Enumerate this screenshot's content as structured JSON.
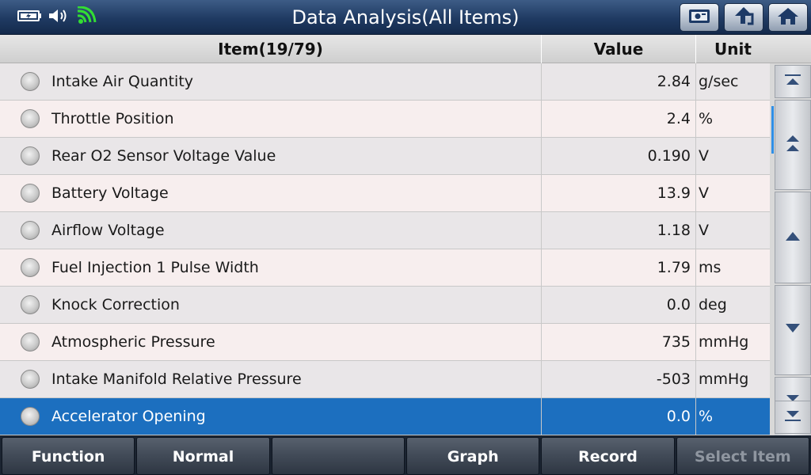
{
  "title": "Data Analysis(All Items)",
  "top_buttons": [
    "screen-capture-icon",
    "back-icon",
    "home-icon"
  ],
  "status_icons": [
    "battery-icon",
    "speaker-icon",
    "wifi-icon"
  ],
  "table": {
    "headers": {
      "item": "Item(19/79)",
      "value": "Value",
      "unit": "Unit"
    },
    "rows": [
      {
        "item": "Intake Air Quantity",
        "value": "2.84",
        "unit": "g/sec"
      },
      {
        "item": "Throttle Position",
        "value": "2.4",
        "unit": "%"
      },
      {
        "item": "Rear O2 Sensor Voltage Value",
        "value": "0.190",
        "unit": "V"
      },
      {
        "item": "Battery Voltage",
        "value": "13.9",
        "unit": "V"
      },
      {
        "item": "Airflow Voltage",
        "value": "1.18",
        "unit": "V"
      },
      {
        "item": "Fuel Injection 1 Pulse Width",
        "value": "1.79",
        "unit": "ms"
      },
      {
        "item": "Knock Correction",
        "value": "0.0",
        "unit": "deg"
      },
      {
        "item": "Atmospheric Pressure",
        "value": "735",
        "unit": "mmHg"
      },
      {
        "item": "Intake Manifold Relative Pressure",
        "value": "-503",
        "unit": "mmHg"
      },
      {
        "item": "Accelerator Opening",
        "value": "0.0",
        "unit": "%",
        "selected": true
      }
    ]
  },
  "bottom_buttons": [
    {
      "label": "Function",
      "enabled": true
    },
    {
      "label": "Normal",
      "enabled": true
    },
    {
      "label": "",
      "enabled": true
    },
    {
      "label": "Graph",
      "enabled": true
    },
    {
      "label": "Record",
      "enabled": true
    },
    {
      "label": "Select Item",
      "enabled": false
    }
  ],
  "colors": {
    "selected_row": "#1c6fbf",
    "wifi": "#33dd33",
    "scroll_indicator": "#2f8fe6"
  }
}
